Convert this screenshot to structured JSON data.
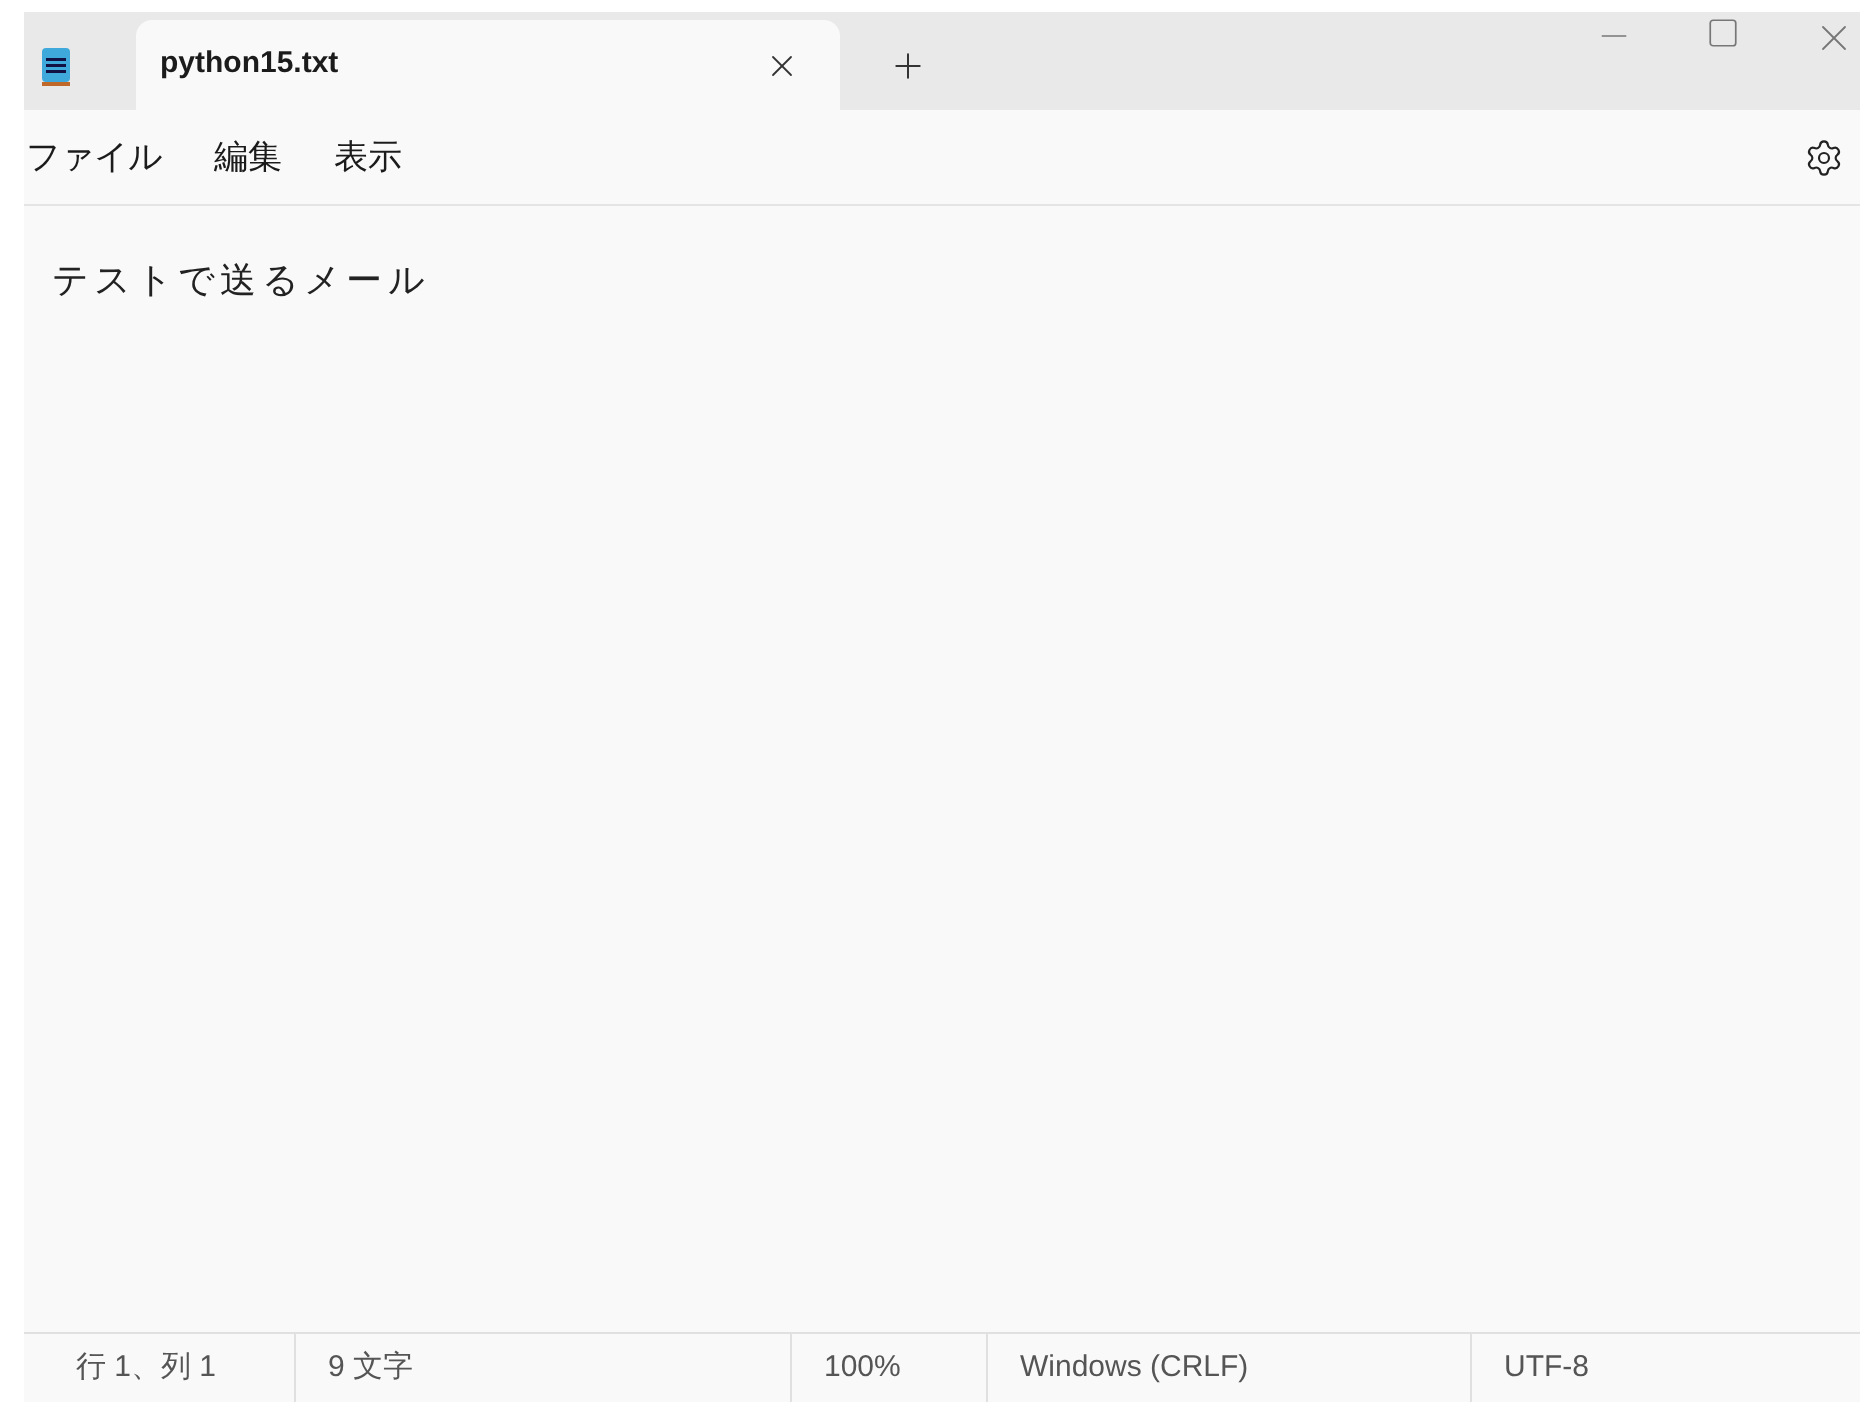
{
  "tabs": [
    {
      "label": "python15.txt",
      "selected": true
    }
  ],
  "menu": [
    "ファイル",
    "編集",
    "表示"
  ],
  "editor": {
    "value": "テストで送るメール"
  },
  "status_bar": [
    "行 1、列 1",
    "9 文字",
    "100%",
    "Windows (CRLF)",
    "UTF-8"
  ]
}
